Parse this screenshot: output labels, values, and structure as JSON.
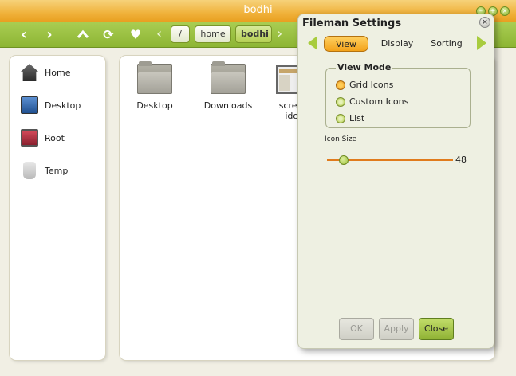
{
  "window": {
    "title": "bodhi",
    "controls": [
      "minimize",
      "maximize",
      "close"
    ]
  },
  "toolbar": {
    "back_icon": "chevron-left-icon",
    "forward_icon": "chevron-right-icon",
    "up_icon": "chevron-up-icon",
    "refresh_icon": "refresh-icon",
    "bookmark_icon": "heart-icon",
    "breadcrumbs": [
      "/",
      "home",
      "bodhi"
    ]
  },
  "sidebar": {
    "items": [
      {
        "label": "Home",
        "icon": "home-icon"
      },
      {
        "label": "Desktop",
        "icon": "desktop-icon"
      },
      {
        "label": "Root",
        "icon": "monitor-icon"
      },
      {
        "label": "Temp",
        "icon": "trash-icon"
      }
    ]
  },
  "files": [
    {
      "name": "Desktop",
      "type": "folder"
    },
    {
      "name": "Downloads",
      "type": "folder"
    },
    {
      "name": "screen",
      "name2": "idor",
      "type": "image"
    }
  ],
  "settings": {
    "title": "Fileman Settings",
    "tabs": [
      "View",
      "Display",
      "Sorting"
    ],
    "active_tab": "View",
    "view_mode": {
      "legend": "View Mode",
      "options": [
        "Grid Icons",
        "Custom Icons",
        "List"
      ],
      "selected": "Grid Icons"
    },
    "icon_size": {
      "label": "Icon Size",
      "value": "48"
    },
    "buttons": {
      "ok": "OK",
      "apply": "Apply",
      "close": "Close"
    }
  },
  "colors": {
    "title_orange": "#f0b13a",
    "toolbar_green": "#98bd3f",
    "accent_orange": "#f3a21a"
  }
}
